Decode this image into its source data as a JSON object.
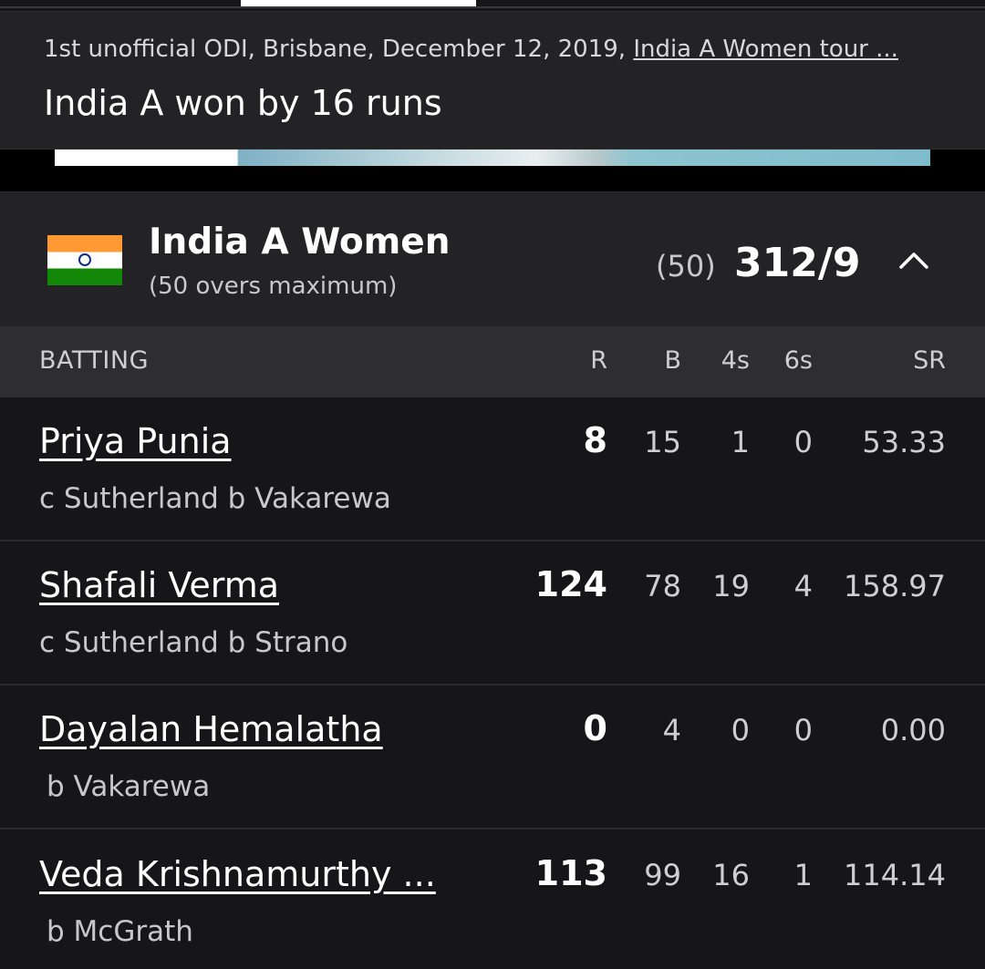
{
  "match": {
    "meta_text": "1st unofficial ODI, Brisbane, December 12, 2019, ",
    "series_link": "India A Women tour ...",
    "result": "India A won by 16 runs"
  },
  "innings": {
    "team_name": "India A Women",
    "team_sub": "(50 overs maximum)",
    "overs": "(50)",
    "score": "312/9",
    "flag_icon": "india-flag-icon",
    "toggle_icon": "chevron-up-icon"
  },
  "batting_header": {
    "label": "BATTING",
    "r": "R",
    "b": "B",
    "fours": "4s",
    "sixes": "6s",
    "sr": "SR"
  },
  "batters": [
    {
      "name": "Priya Punia",
      "dismissal": "c Sutherland b Vakarewa",
      "r": "8",
      "b": "15",
      "fours": "1",
      "sixes": "0",
      "sr": "53.33"
    },
    {
      "name": "Shafali Verma",
      "dismissal": "c Sutherland b Strano",
      "r": "124",
      "b": "78",
      "fours": "19",
      "sixes": "4",
      "sr": "158.97"
    },
    {
      "name": "Dayalan Hemalatha",
      "dismissal": "b Vakarewa",
      "r": "0",
      "b": "4",
      "fours": "0",
      "sixes": "0",
      "sr": "0.00"
    },
    {
      "name": "Veda Krishnamurthy ...",
      "dismissal": "b McGrath",
      "r": "113",
      "b": "99",
      "fours": "16",
      "sixes": "1",
      "sr": "114.14"
    }
  ],
  "colors": {
    "background": "#161618",
    "panel": "#232325",
    "header_band": "#2e2e31",
    "text_primary": "#ffffff",
    "text_secondary": "#c8c8c8"
  }
}
